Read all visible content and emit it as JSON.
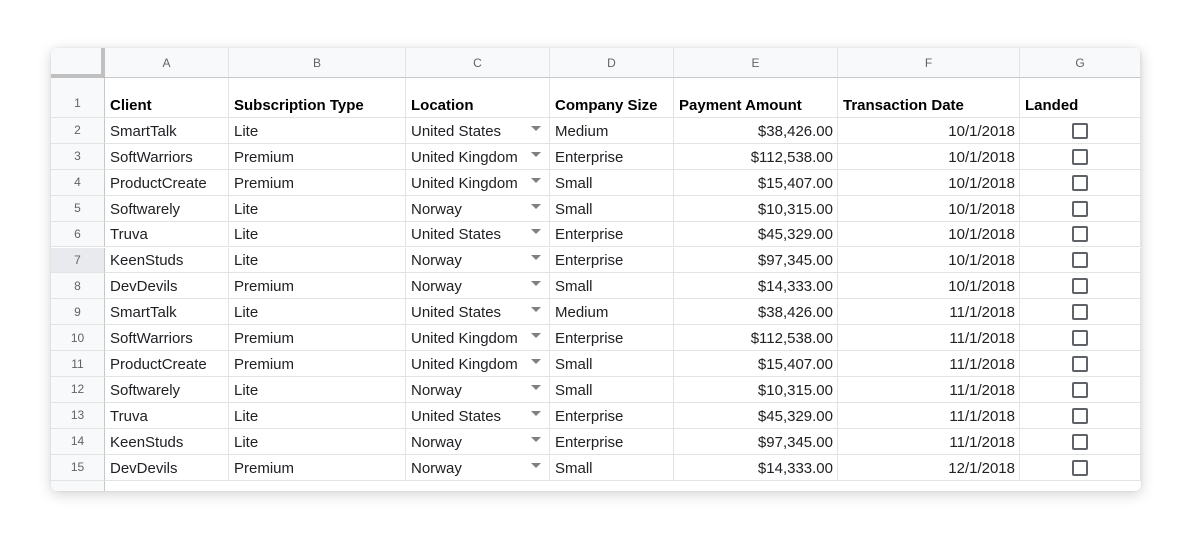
{
  "columns": [
    "A",
    "B",
    "C",
    "D",
    "E",
    "F",
    "G"
  ],
  "row_numbers": [
    "1",
    "2",
    "3",
    "4",
    "5",
    "6",
    "7",
    "8",
    "9",
    "10",
    "11",
    "12",
    "13",
    "14",
    "15"
  ],
  "headers": {
    "client": "Client",
    "subscription_type": "Subscription Type",
    "location": "Location",
    "company_size": "Company Size",
    "payment_amount": "Payment Amount",
    "transaction_date": "Transaction Date",
    "landed": "Landed"
  },
  "rows": [
    {
      "client": "SmartTalk",
      "subscription": "Lite",
      "location": "United States",
      "size": "Medium",
      "amount": "$38,426.00",
      "date": "10/1/2018",
      "landed": false
    },
    {
      "client": "SoftWarriors",
      "subscription": "Premium",
      "location": "United Kingdom",
      "size": "Enterprise",
      "amount": "$112,538.00",
      "date": "10/1/2018",
      "landed": false
    },
    {
      "client": "ProductCreate",
      "subscription": "Premium",
      "location": "United Kingdom",
      "size": "Small",
      "amount": "$15,407.00",
      "date": "10/1/2018",
      "landed": false
    },
    {
      "client": "Softwarely",
      "subscription": "Lite",
      "location": "Norway",
      "size": "Small",
      "amount": "$10,315.00",
      "date": "10/1/2018",
      "landed": false
    },
    {
      "client": "Truva",
      "subscription": "Lite",
      "location": "United States",
      "size": "Enterprise",
      "amount": "$45,329.00",
      "date": "10/1/2018",
      "landed": false
    },
    {
      "client": "KeenStuds",
      "subscription": "Lite",
      "location": "Norway",
      "size": "Enterprise",
      "amount": "$97,345.00",
      "date": "10/1/2018",
      "landed": false
    },
    {
      "client": "DevDevils",
      "subscription": "Premium",
      "location": "Norway",
      "size": "Small",
      "amount": "$14,333.00",
      "date": "10/1/2018",
      "landed": false
    },
    {
      "client": "SmartTalk",
      "subscription": "Lite",
      "location": "United States",
      "size": "Medium",
      "amount": "$38,426.00",
      "date": "11/1/2018",
      "landed": false
    },
    {
      "client": "SoftWarriors",
      "subscription": "Premium",
      "location": "United Kingdom",
      "size": "Enterprise",
      "amount": "$112,538.00",
      "date": "11/1/2018",
      "landed": false
    },
    {
      "client": "ProductCreate",
      "subscription": "Premium",
      "location": "United Kingdom",
      "size": "Small",
      "amount": "$15,407.00",
      "date": "11/1/2018",
      "landed": false
    },
    {
      "client": "Softwarely",
      "subscription": "Lite",
      "location": "Norway",
      "size": "Small",
      "amount": "$10,315.00",
      "date": "11/1/2018",
      "landed": false
    },
    {
      "client": "Truva",
      "subscription": "Lite",
      "location": "United States",
      "size": "Enterprise",
      "amount": "$45,329.00",
      "date": "11/1/2018",
      "landed": false
    },
    {
      "client": "KeenStuds",
      "subscription": "Lite",
      "location": "Norway",
      "size": "Enterprise",
      "amount": "$97,345.00",
      "date": "11/1/2018",
      "landed": false
    },
    {
      "client": "DevDevils",
      "subscription": "Premium",
      "location": "Norway",
      "size": "Small",
      "amount": "$14,333.00",
      "date": "12/1/2018",
      "landed": false
    }
  ],
  "icons": {
    "dropdown": "chevron-down-icon",
    "checkbox": "checkbox-icon"
  },
  "colors": {
    "header_bg": "#f8f9fa",
    "grid_line": "#e2e3e3",
    "header_text": "#5f6368",
    "cell_text": "#202124"
  }
}
